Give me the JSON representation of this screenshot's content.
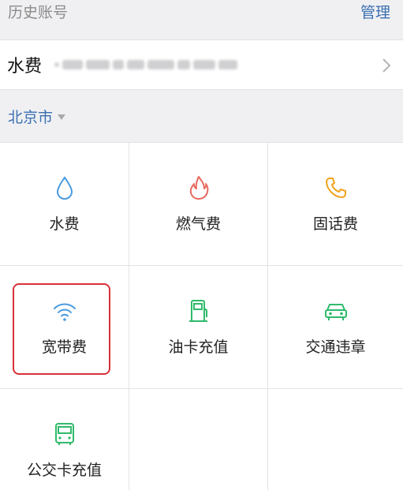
{
  "history": {
    "title": "历史账号",
    "manage_label": "管理"
  },
  "account": {
    "type": "水费",
    "number": ""
  },
  "city": {
    "name": "北京市"
  },
  "services": [
    {
      "label": "水费",
      "icon": "water-drop-icon",
      "color": "#4a9be0"
    },
    {
      "label": "燃气费",
      "icon": "flame-icon",
      "color": "#e86a5e"
    },
    {
      "label": "固话费",
      "icon": "phone-icon",
      "color": "#f1a21c"
    },
    {
      "label": "宽带费",
      "icon": "wifi-icon",
      "color": "#4a9be0",
      "selected": true
    },
    {
      "label": "油卡充值",
      "icon": "fuel-pump-icon",
      "color": "#2fba6a"
    },
    {
      "label": "交通违章",
      "icon": "car-icon",
      "color": "#2fba6a"
    },
    {
      "label": "公交卡充值",
      "icon": "bus-icon",
      "color": "#2fba6a"
    }
  ]
}
